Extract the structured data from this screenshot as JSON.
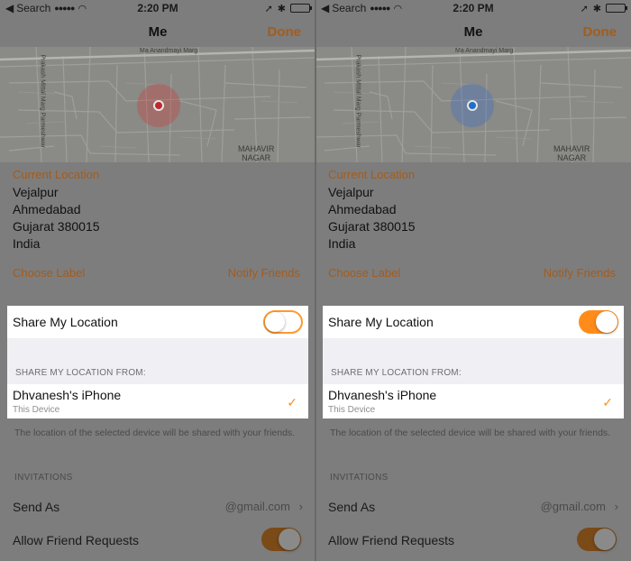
{
  "status_bar": {
    "back_label": "Search",
    "time": "2:20 PM"
  },
  "nav": {
    "title": "Me",
    "done_label": "Done"
  },
  "map": {
    "road_label_top": "Ma Anandmayi Marg",
    "road_label_vertical": "Prakash Mittal Marg Parmeshwar",
    "area_label_line1": "MAHAVIR",
    "area_label_line2": "NAGAR"
  },
  "location": {
    "section_label": "Current Location",
    "address_lines": [
      "Vejalpur",
      "Ahmedabad",
      "Gujarat 380015",
      "India"
    ],
    "choose_label": "Choose Label",
    "notify_friends": "Notify Friends"
  },
  "share": {
    "label": "Share My Location",
    "from_header": "SHARE MY LOCATION FROM:",
    "device_name": "Dhvanesh's iPhone",
    "device_sub": "This Device",
    "footnote": "The location of the selected device will be shared with your friends."
  },
  "invitations": {
    "header": "INVITATIONS",
    "send_as_label": "Send As",
    "send_as_value": "@gmail.com",
    "allow_requests_label": "Allow Friend Requests"
  },
  "panels": [
    {
      "id": "left",
      "share_enabled": false,
      "pin_color": "#c0282e"
    },
    {
      "id": "right",
      "share_enabled": true,
      "pin_color": "#1f6fc9"
    }
  ],
  "colors": {
    "accent": "#ff8c1a",
    "accent_dim": "#a35c1e",
    "highlight_bg": "#ffffff"
  },
  "icons": {
    "checkmark": "checkmark-icon",
    "chevron": "chevron-right-icon",
    "location_arrow": "location-arrow-icon",
    "bluetooth": "bluetooth-icon",
    "wifi": "wifi-icon",
    "battery": "battery-icon"
  }
}
